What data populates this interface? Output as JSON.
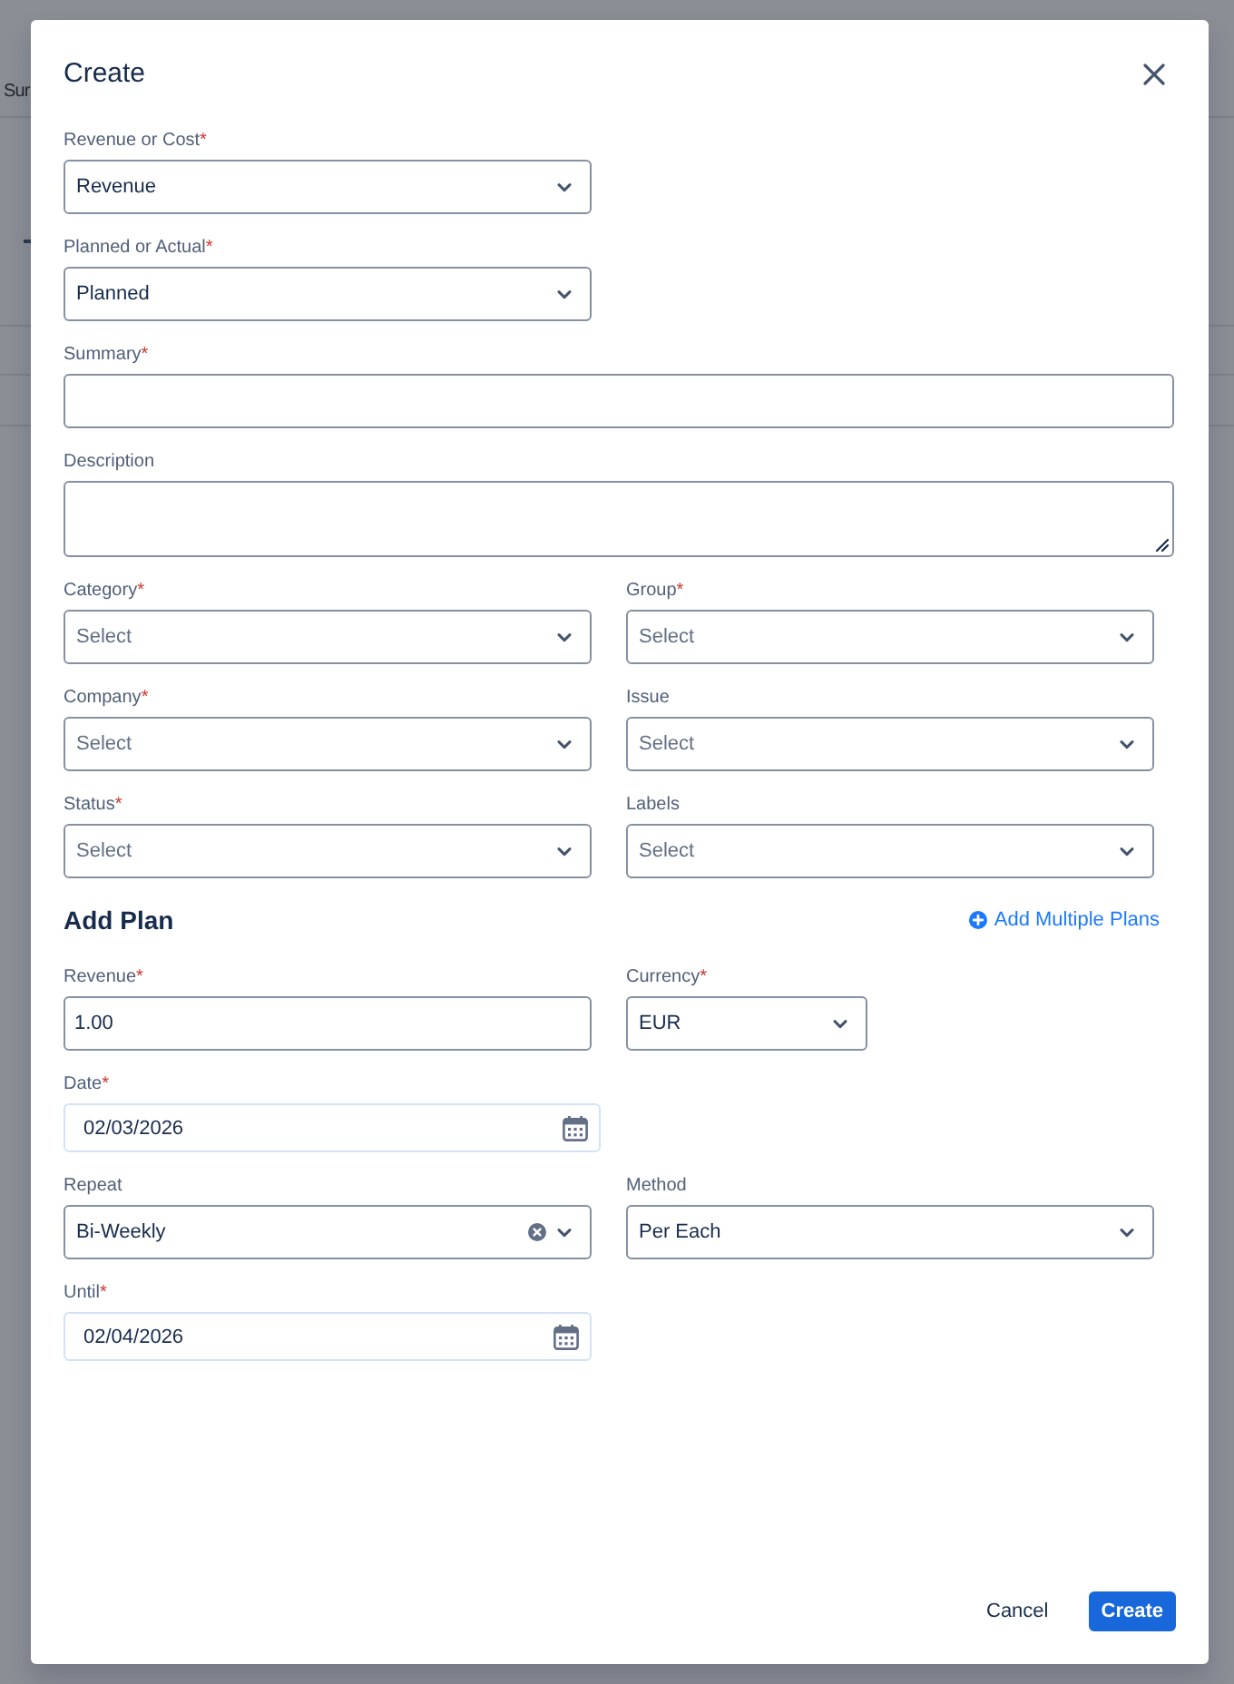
{
  "background": {
    "tab_text": "Sur"
  },
  "dialog": {
    "title": "Create"
  },
  "details": [
    {
      "kind": "select",
      "label": "Revenue or Cost",
      "required_mark": "*",
      "value": "Revenue"
    },
    {
      "kind": "select",
      "label": "Planned or Actual",
      "required_mark": "*",
      "value": "Planned"
    },
    {
      "kind": "text",
      "label": "Summary",
      "required_mark": "*"
    },
    {
      "kind": "textarea",
      "label": "Description"
    },
    {
      "kind": "select",
      "label": "Category",
      "required_mark": "*",
      "placeholder": "Select"
    },
    {
      "kind": "select",
      "label": "Group",
      "required_mark": "*",
      "placeholder": "Select"
    },
    {
      "kind": "select",
      "label": "Company",
      "required_mark": "*",
      "placeholder": "Select"
    },
    {
      "kind": "select",
      "label": "Issue",
      "placeholder": "Select"
    },
    {
      "kind": "select",
      "label": "Status",
      "required_mark": "*",
      "placeholder": "Select"
    },
    {
      "kind": "select",
      "label": "Labels",
      "placeholder": "Select"
    }
  ],
  "plan": {
    "title": "Add Plan",
    "link": "Add Multiple Plans",
    "fields": [
      {
        "kind": "text",
        "label": "Revenue",
        "required_mark": "*",
        "value": "1.00",
        "clearable": false
      },
      {
        "kind": "select",
        "label": "Currency",
        "required_mark": "*",
        "value": "EUR",
        "clearable": false
      },
      {
        "kind": "date",
        "label": "Date",
        "required_mark": "*",
        "value": "02/03/2026",
        "clearable": false
      },
      {
        "kind": "select",
        "label": "Repeat",
        "value": "Bi-Weekly",
        "clearable": true
      },
      {
        "kind": "select",
        "label": "Method",
        "value": "Per Each",
        "clearable": false
      },
      {
        "kind": "date",
        "label": "Until",
        "required_mark": "*",
        "value": "02/04/2026",
        "clearable": false
      }
    ]
  },
  "footer": {
    "buttons": [
      {
        "label": "Cancel",
        "kind": "subtle"
      },
      {
        "label": "Create",
        "kind": "primary"
      }
    ]
  }
}
